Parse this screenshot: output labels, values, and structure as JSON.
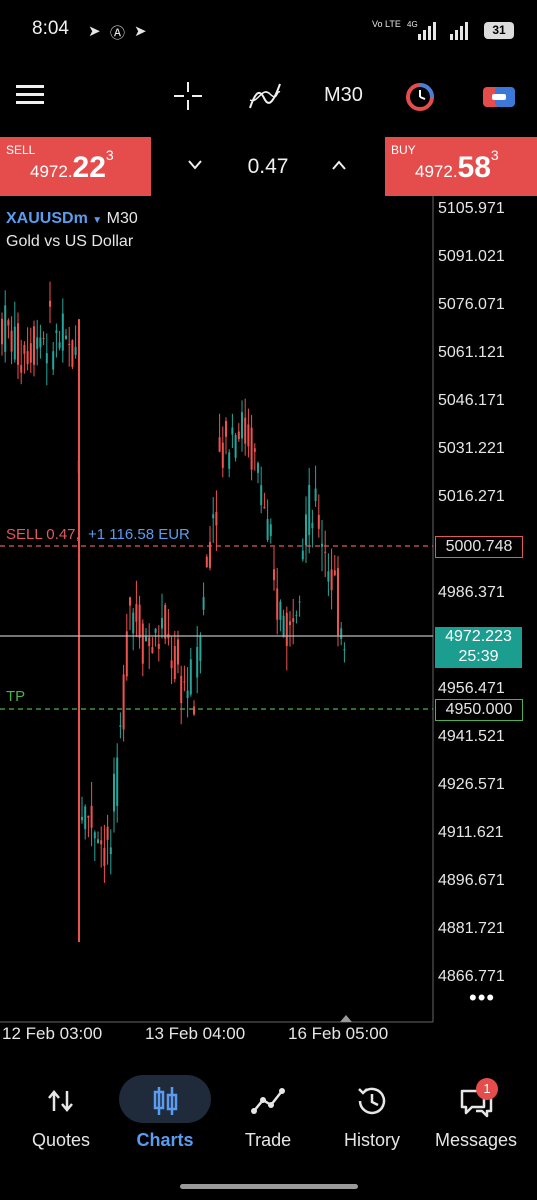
{
  "status_bar": {
    "time": "8:04",
    "network": "Vo LTE",
    "network_gen": "4G",
    "battery": "31"
  },
  "toolbar": {
    "timeframe": "M30",
    "icons": [
      "menu-icon",
      "crosshair-icon",
      "indicators-icon",
      "timeframe-label",
      "clock-icon",
      "trade-icon"
    ]
  },
  "order_bar": {
    "sell_label": "SELL",
    "sell_price_small": "4972.",
    "sell_price_big": "22",
    "sell_price_sup": "3",
    "buy_label": "BUY",
    "buy_price_small": "4972.",
    "buy_price_big": "58",
    "buy_price_sup": "3",
    "lot": "0.47"
  },
  "chart": {
    "symbol": "XAUUSDm",
    "symbol_arrow": "▼",
    "timeframe": "M30",
    "description": "Gold vs US Dollar",
    "position_label": "SELL 0.47,",
    "position_pl": "+1 116.58 EUR",
    "tp_label": "TP",
    "sell_level": "5000.748",
    "tp_level": "4950.000",
    "bid_price": "4972.223",
    "bid_timer": "25:39",
    "y_ticks": [
      "5105.971",
      "5091.021",
      "5076.071",
      "5061.121",
      "5046.171",
      "5031.221",
      "5016.271",
      "4986.371",
      "4956.471",
      "4941.521",
      "4926.571",
      "4911.621",
      "4896.671",
      "4881.721",
      "4866.771"
    ],
    "x_ticks": [
      "12 Feb 03:00",
      "13 Feb 04:00",
      "16 Feb 05:00"
    ],
    "colors": {
      "bull": "#26a69a",
      "bear": "#ef5350",
      "sell_line": "#e05a5a",
      "tp_line": "#4caf50",
      "bid_line": "#bdbdbd"
    }
  },
  "nav": {
    "quotes": "Quotes",
    "charts": "Charts",
    "trade": "Trade",
    "history": "History",
    "messages": "Messages",
    "messages_badge": "1"
  }
}
